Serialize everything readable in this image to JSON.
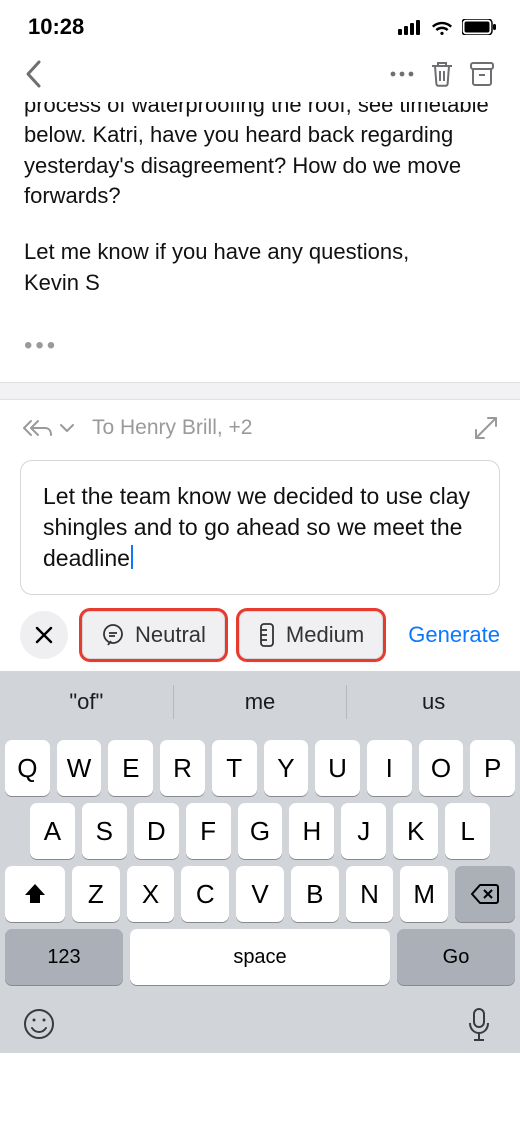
{
  "status": {
    "time": "10:28"
  },
  "email": {
    "body_line_cutoff": "process of waterproofing the roof, see timetable",
    "body_rest": "below. Katri, have you heard back regarding yesterday's disagreement? How do we move forwards?",
    "signoff_line1": "Let me know if you have any questions,",
    "signoff_line2": "Kevin S"
  },
  "reply": {
    "to_label": "To Henry Brill, +2",
    "compose_text": "Let the team know we decided to use clay shingles and to go ahead so we meet the deadline"
  },
  "chips": {
    "tone_label": "Neutral",
    "length_label": "Medium",
    "generate_label": "Generate"
  },
  "suggestions": {
    "s1": "\"of\"",
    "s2": "me",
    "s3": "us"
  },
  "keys": {
    "r1": [
      "Q",
      "W",
      "E",
      "R",
      "T",
      "Y",
      "U",
      "I",
      "O",
      "P"
    ],
    "r2": [
      "A",
      "S",
      "D",
      "F",
      "G",
      "H",
      "J",
      "K",
      "L"
    ],
    "r3": [
      "Z",
      "X",
      "C",
      "V",
      "B",
      "N",
      "M"
    ],
    "num": "123",
    "space": "space",
    "go": "Go"
  }
}
